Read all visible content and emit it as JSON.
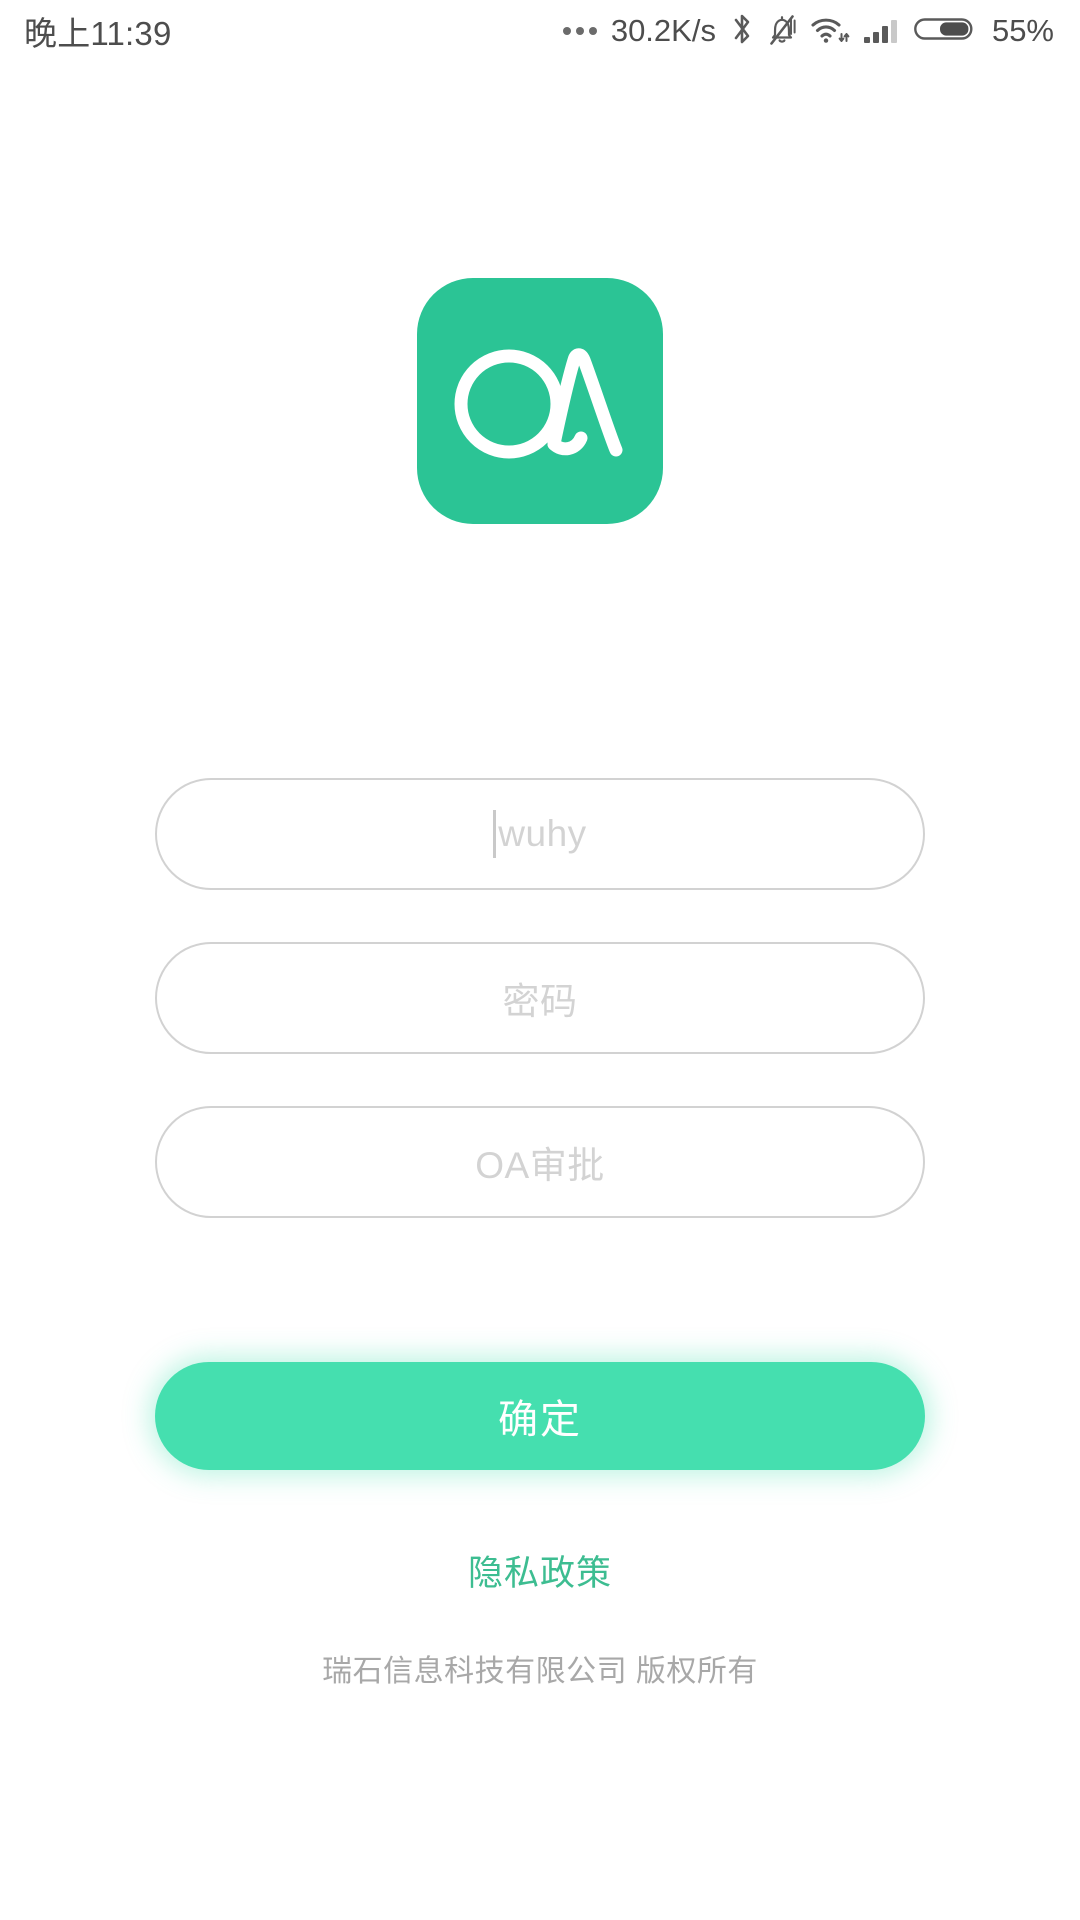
{
  "status_bar": {
    "time": "晚上11:39",
    "network_speed": "30.2K/s",
    "battery_percent": "55%",
    "icons": {
      "more_dots": "more-dots-icon",
      "bluetooth": "bluetooth-icon",
      "silent": "bell-muted-icon",
      "wifi": "wifi-icon",
      "signal": "cellular-signal-icon",
      "battery": "battery-icon"
    },
    "battery_level": 55
  },
  "logo": {
    "name": "oa-app-logo",
    "alt": "OA",
    "background_color": "#2bc495",
    "mark_color": "#ffffff"
  },
  "form": {
    "username": {
      "value": "wuhy",
      "placeholder": "wuhy",
      "has_caret": true
    },
    "password": {
      "value": "",
      "placeholder": "密码"
    },
    "server": {
      "value": "",
      "placeholder": "OA审批"
    },
    "submit_label": "确定"
  },
  "footer": {
    "privacy_label": "隐私政策",
    "copyright": "瑞石信息科技有限公司 版权所有"
  },
  "colors": {
    "brand_green": "#2bc495",
    "button_green": "#45dfaf",
    "link_green": "#3dbd91",
    "field_border": "#d2d2d2",
    "placeholder": "#d3d3d3",
    "copyright_gray": "#a8a8a8"
  }
}
